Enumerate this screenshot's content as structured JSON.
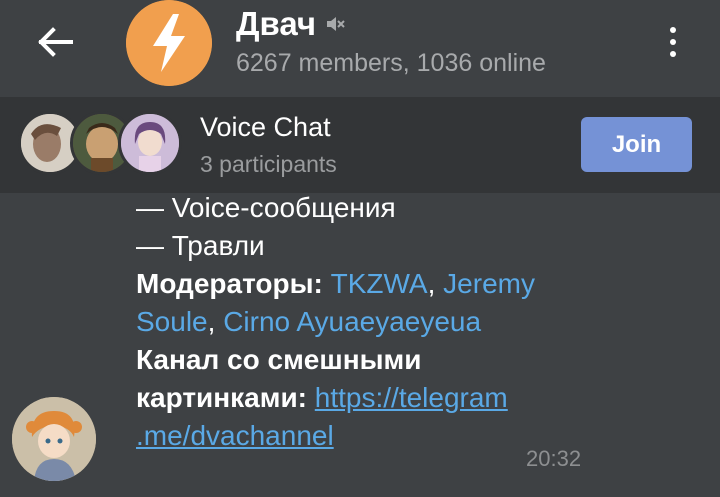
{
  "header": {
    "title": "Двач",
    "subtitle": "6267 members, 1036 online",
    "accent": "#f19f4e"
  },
  "voice_chat": {
    "title": "Voice Chat",
    "subtitle": "3 participants",
    "join_label": "Join",
    "join_color": "#7592d6"
  },
  "message": {
    "line_voice": "— Voice-сообщения",
    "line_travli": "— Травли",
    "moderators_label": "Модераторы:",
    "mod1": "TKZWA",
    "mod2a": "Jeremy",
    "mod2b": "Soule",
    "mod3": "Cirno Ayuaeyaeyeua",
    "channel_label_1": "Канал со смешными",
    "channel_label_2": "картинками:",
    "link_1": "https://telegram",
    "link_2": ".me/dvachannel",
    "time": "20:32",
    "link_color": "#5aa9e6"
  }
}
